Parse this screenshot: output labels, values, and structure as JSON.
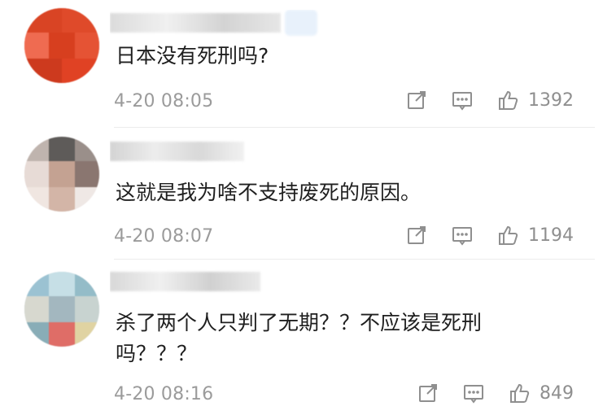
{
  "comments": [
    {
      "text": "日本没有死刑吗?",
      "time": "4-20 08:05",
      "likes": "1392",
      "avatar_icon": "avatar",
      "colors": [
        "#e04224",
        "#d94021",
        "#e64827",
        "#ef6b51",
        "#cd3a1e"
      ]
    },
    {
      "text": "这就是我为啥不支持废死的原因。",
      "time": "4-20 08:07",
      "likes": "1194",
      "avatar_icon": "avatar",
      "colors": [
        "#6f6a67",
        "#bca89e",
        "#e2d5cf",
        "#8a7670",
        "#f0e6e1"
      ]
    },
    {
      "text": "杀了两个人只判了无期？？不应该是死刑吗？？？",
      "time": "4-20 08:16",
      "likes": "849",
      "avatar_icon": "avatar",
      "colors": [
        "#94bcc8",
        "#d7d8cf",
        "#a3b7bf",
        "#df6d67",
        "#e0d3a2"
      ]
    }
  ],
  "icons": {
    "share": "share-icon",
    "comment": "comment-icon",
    "like": "thumbs-up-icon"
  }
}
